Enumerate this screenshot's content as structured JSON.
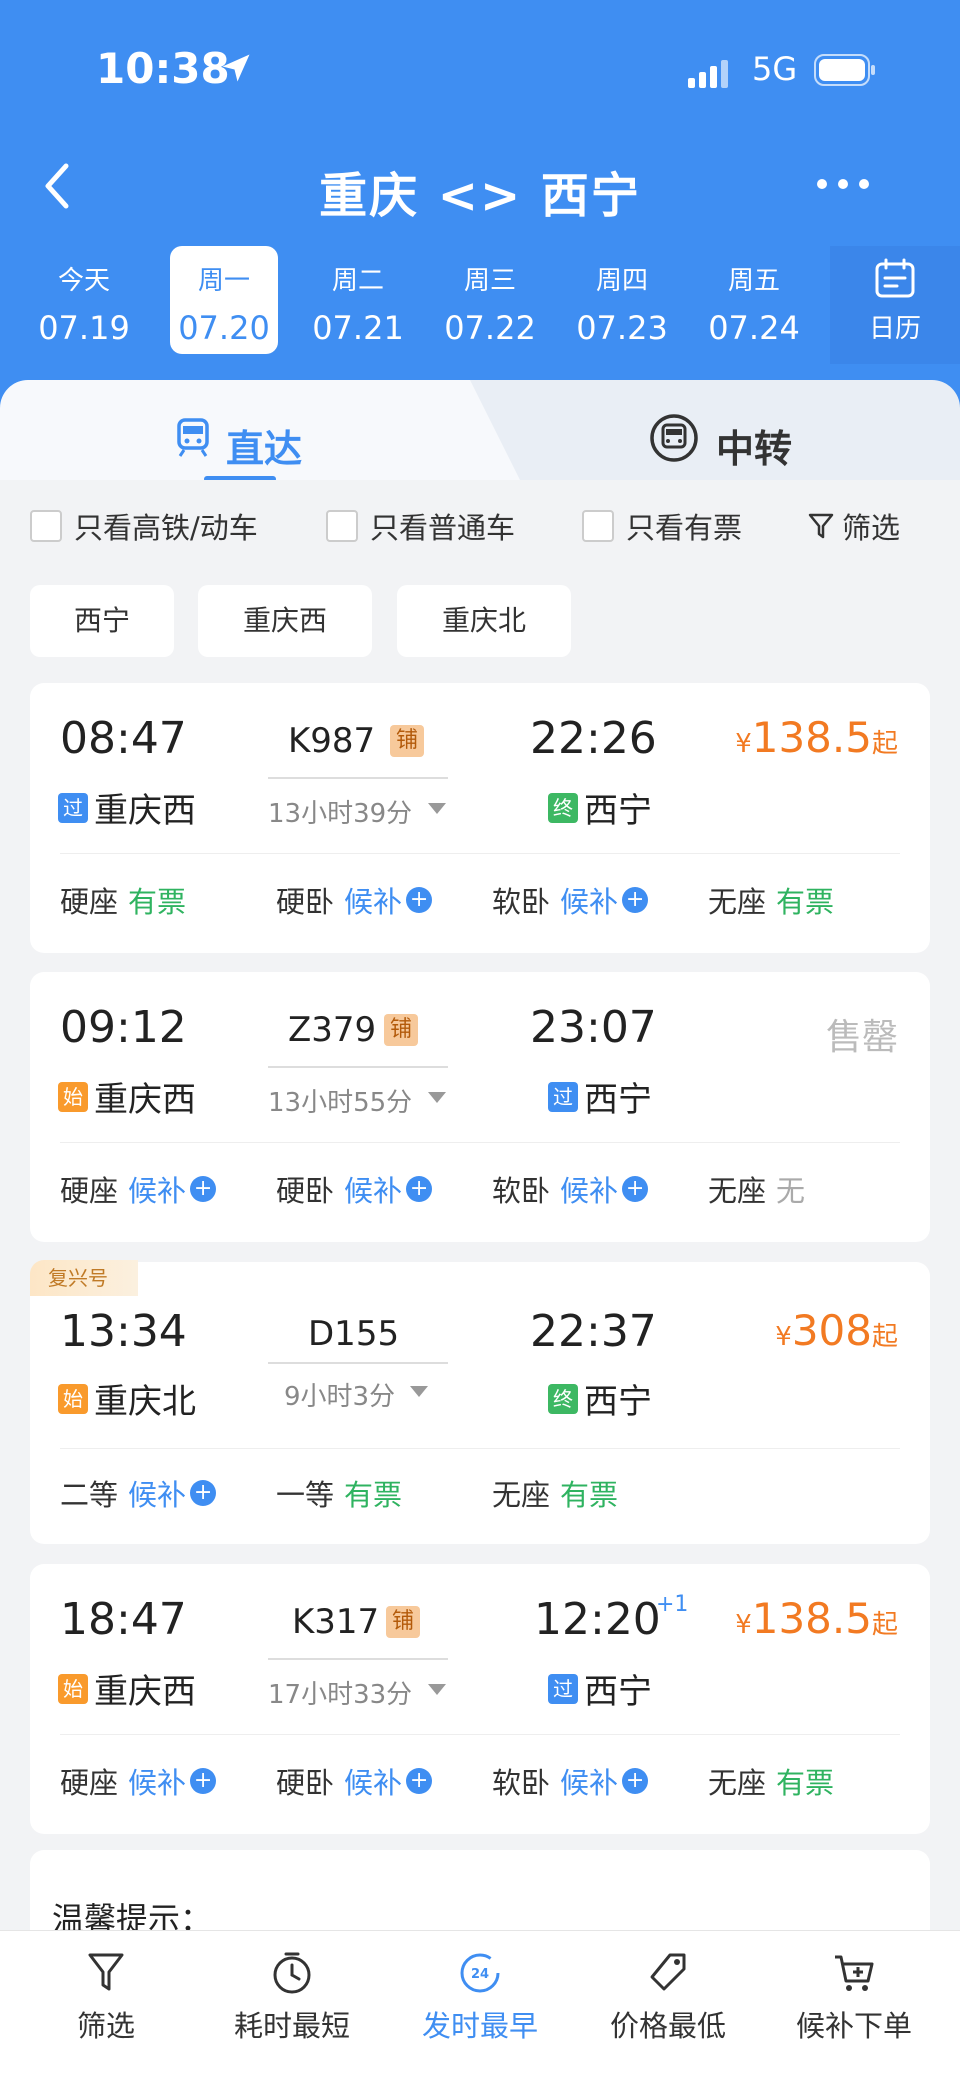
{
  "status_bar": {
    "time": "10:38",
    "network": "5G"
  },
  "nav": {
    "title": "重庆 <> 西宁"
  },
  "dates": [
    {
      "weekday": "今天",
      "date": "07.19",
      "active": false
    },
    {
      "weekday": "周一",
      "date": "07.20",
      "active": true
    },
    {
      "weekday": "周二",
      "date": "07.21",
      "active": false
    },
    {
      "weekday": "周三",
      "date": "07.22",
      "active": false
    },
    {
      "weekday": "周四",
      "date": "07.23",
      "active": false
    },
    {
      "weekday": "周五",
      "date": "07.24",
      "active": false
    }
  ],
  "calendar_label": "日历",
  "tabs": {
    "direct": "直达",
    "transfer": "中转"
  },
  "filters": {
    "high_speed": "只看高铁/动车",
    "normal": "只看普通车",
    "available": "只看有票",
    "filter": "筛选"
  },
  "stations": [
    "西宁",
    "重庆西",
    "重庆北"
  ],
  "trains": [
    {
      "dep_time": "08:47",
      "arr_time": "22:26",
      "train_no": "K987",
      "berth": "铺",
      "duration": "13小时39分",
      "dep_tag": "过",
      "dep_station": "重庆西",
      "arr_tag": "终",
      "arr_station": "西宁",
      "price_symbol": "¥",
      "price": "138.5",
      "price_suffix": "起",
      "seats": [
        {
          "name": "硬座",
          "status": "有票"
        },
        {
          "name": "硬卧",
          "status": "候补"
        },
        {
          "name": "软卧",
          "status": "候补"
        },
        {
          "name": "无座",
          "status": "有票"
        }
      ]
    },
    {
      "dep_time": "09:12",
      "arr_time": "23:07",
      "train_no": "Z379",
      "berth": "铺",
      "duration": "13小时55分",
      "dep_tag": "始",
      "dep_station": "重庆西",
      "arr_tag": "过",
      "arr_station": "西宁",
      "soldout": "售罄",
      "seats": [
        {
          "name": "硬座",
          "status": "候补"
        },
        {
          "name": "硬卧",
          "status": "候补"
        },
        {
          "name": "软卧",
          "status": "候补"
        },
        {
          "name": "无座",
          "status": "无"
        }
      ]
    },
    {
      "badge": "复兴号",
      "dep_time": "13:34",
      "arr_time": "22:37",
      "train_no": "D155",
      "duration": "9小时3分",
      "dep_tag": "始",
      "dep_station": "重庆北",
      "arr_tag": "终",
      "arr_station": "西宁",
      "price_symbol": "¥",
      "price": "308",
      "price_suffix": "起",
      "seats": [
        {
          "name": "二等",
          "status": "候补"
        },
        {
          "name": "一等",
          "status": "有票"
        },
        {
          "name": "无座",
          "status": "有票"
        }
      ]
    },
    {
      "dep_time": "18:47",
      "arr_time": "12:20",
      "arr_plus": "+1",
      "train_no": "K317",
      "berth": "铺",
      "duration": "17小时33分",
      "dep_tag": "始",
      "dep_station": "重庆西",
      "arr_tag": "过",
      "arr_station": "西宁",
      "price_symbol": "¥",
      "price": "138.5",
      "price_suffix": "起",
      "seats": [
        {
          "name": "硬座",
          "status": "候补"
        },
        {
          "name": "硬卧",
          "status": "候补"
        },
        {
          "name": "软卧",
          "status": "候补"
        },
        {
          "name": "无座",
          "status": "有票"
        }
      ]
    }
  ],
  "tips_title": "温馨提示：",
  "bottom_bar": [
    {
      "label": "筛选",
      "icon": "funnel-icon",
      "active": false
    },
    {
      "label": "耗时最短",
      "icon": "clock-icon",
      "active": false
    },
    {
      "label": "发时最早",
      "icon": "24h-icon",
      "icon_text": "24",
      "active": true
    },
    {
      "label": "价格最低",
      "icon": "price-tag-icon",
      "active": false
    },
    {
      "label": "候补下单",
      "icon": "cart-icon",
      "active": false
    }
  ],
  "colors": {
    "primary": "#3f8ef2",
    "price": "#f27a22",
    "available": "#2fb360",
    "soldout": "#bbbbbb"
  }
}
